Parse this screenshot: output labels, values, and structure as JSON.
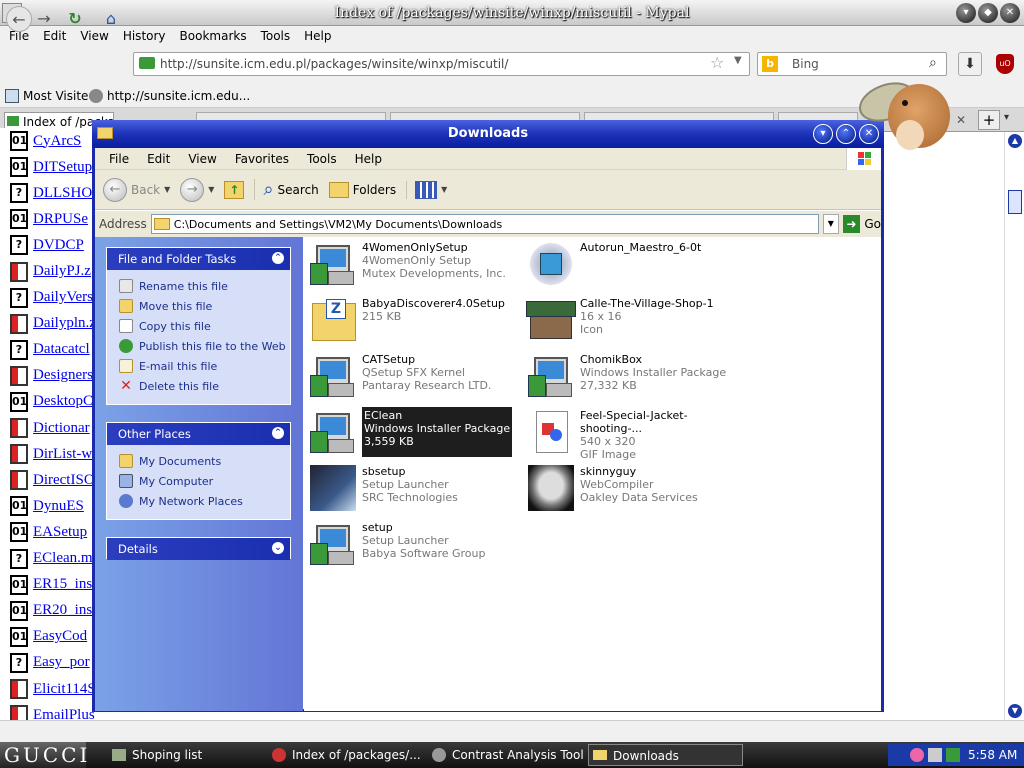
{
  "browser": {
    "title": "Index of /packages/winsite/winxp/miscutil - Mypal",
    "menu": [
      "File",
      "Edit",
      "View",
      "History",
      "Bookmarks",
      "Tools",
      "Help"
    ],
    "url": "http://sunsite.icm.edu.pl/packages/winsite/winxp/miscutil/",
    "search_placeholder": "Bing",
    "bookmarks": [
      "Most Visited",
      "http://sunsite.icm.edu..."
    ],
    "tab_label": "Index of /packa"
  },
  "page_list": [
    {
      "name": "CyArcS",
      "icon": "binary"
    },
    {
      "name": "DITSetup",
      "icon": "binary"
    },
    {
      "name": "DLLSHO",
      "icon": "unknown"
    },
    {
      "name": "DRPUSe",
      "icon": "binary"
    },
    {
      "name": "DVDCP",
      "icon": "unknown"
    },
    {
      "name": "DailyPJ.z",
      "icon": "compressed"
    },
    {
      "name": "DailyVers",
      "icon": "unknown"
    },
    {
      "name": "Dailypln.z",
      "icon": "compressed"
    },
    {
      "name": "Datacatcl",
      "icon": "unknown"
    },
    {
      "name": "Designers",
      "icon": "compressed"
    },
    {
      "name": "DesktopC",
      "icon": "binary"
    },
    {
      "name": "Dictionar",
      "icon": "compressed"
    },
    {
      "name": "DirList-w",
      "icon": "compressed"
    },
    {
      "name": "DirectISO",
      "icon": "compressed"
    },
    {
      "name": "DynuES",
      "icon": "binary"
    },
    {
      "name": "EASetup",
      "icon": "binary"
    },
    {
      "name": "EClean.m",
      "icon": "unknown"
    },
    {
      "name": "ER15_ins",
      "icon": "binary"
    },
    {
      "name": "ER20_ins",
      "icon": "binary"
    },
    {
      "name": "EasyCod",
      "icon": "binary"
    },
    {
      "name": "Easy_por",
      "icon": "unknown"
    },
    {
      "name": "Elicit114S",
      "icon": "compressed"
    },
    {
      "name": "EmailPlus",
      "icon": "compressed"
    }
  ],
  "explorer": {
    "title": "Downloads",
    "menu": [
      "File",
      "Edit",
      "View",
      "Favorites",
      "Tools",
      "Help"
    ],
    "toolbar": {
      "back": "Back",
      "search": "Search",
      "folders": "Folders"
    },
    "address_label": "Address",
    "address": "C:\\Documents and Settings\\VM2\\My Documents\\Downloads",
    "go": "Go",
    "tasks_panel": {
      "title": "File and Folder Tasks",
      "items": [
        "Rename this file",
        "Move this file",
        "Copy this file",
        "Publish this file to the Web",
        "E-mail this file",
        "Delete this file"
      ]
    },
    "places_panel": {
      "title": "Other Places",
      "items": [
        "My Documents",
        "My Computer",
        "My Network Places"
      ]
    },
    "details_panel": {
      "title": "Details"
    },
    "files": [
      {
        "name": "4WomenOnlySetup",
        "line2": "4WomenOnly Setup",
        "line3": "Mutex Developments, Inc.",
        "icon": "installer"
      },
      {
        "name": "Autorun_Maestro_6-0t",
        "line2": "",
        "line3": "",
        "icon": "cd-app"
      },
      {
        "name": "BabyaDiscoverer4.0Setup",
        "line2": "215 KB",
        "line3": "",
        "icon": "zip-folder"
      },
      {
        "name": "Calle-The-Village-Shop-1",
        "line2": "16 x 16",
        "line3": "Icon",
        "icon": "shop"
      },
      {
        "name": "CATSetup",
        "line2": "QSetup SFX Kernel",
        "line3": "Pantaray Research LTD.",
        "icon": "installer"
      },
      {
        "name": "ChomikBox",
        "line2": "Windows Installer Package",
        "line3": "27,332 KB",
        "icon": "installer"
      },
      {
        "name": "EClean",
        "line2": "Windows Installer Package",
        "line3": "3,559 KB",
        "icon": "installer",
        "selected": true
      },
      {
        "name": "Feel-Special-Jacket-shooting-...",
        "line2": "540 x 320",
        "line3": "GIF Image",
        "icon": "gif"
      },
      {
        "name": "sbsetup",
        "line2": "Setup Launcher",
        "line3": "SRC Technologies",
        "icon": "sb"
      },
      {
        "name": "skinnyguy",
        "line2": "WebCompiler",
        "line3": "Oakley Data Services",
        "icon": "photo"
      },
      {
        "name": "setup",
        "line2": "Setup Launcher",
        "line3": "Babya Software Group",
        "icon": "installer"
      }
    ]
  },
  "taskbar": {
    "start": "GUCCI",
    "tasks": [
      "Shoping list",
      "Index of /packages/...",
      "Contrast Analysis Tool",
      "Downloads"
    ],
    "clock": "5:58 AM"
  }
}
